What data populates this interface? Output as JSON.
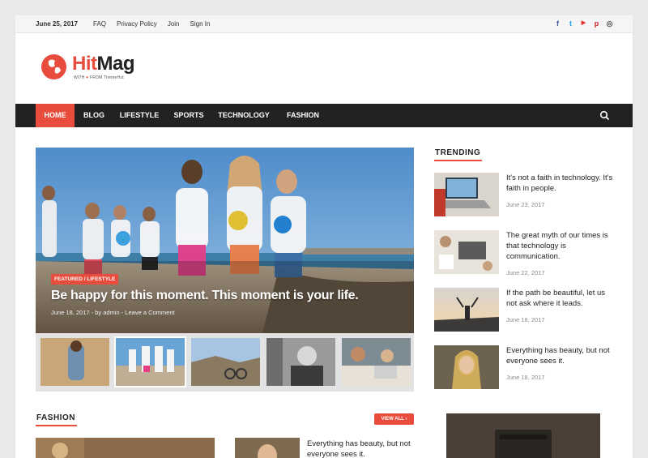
{
  "topbar": {
    "date": "June 25, 2017",
    "links": [
      "FAQ",
      "Privacy Policy",
      "Join",
      "Sign In"
    ],
    "social": [
      {
        "icon": "facebook-icon",
        "glyph": "f",
        "color": "#3b5998"
      },
      {
        "icon": "twitter-icon",
        "glyph": "t",
        "color": "#1da1f2"
      },
      {
        "icon": "youtube-icon",
        "glyph": "▶",
        "color": "#e52d27"
      },
      {
        "icon": "pinterest-icon",
        "glyph": "p",
        "color": "#cb2027"
      },
      {
        "icon": "instagram-icon",
        "glyph": "◎",
        "color": "#555555"
      }
    ]
  },
  "logo": {
    "hit": "Hit",
    "mag": "Mag",
    "tag_with": "WITH",
    "tag_heart": "♥",
    "tag_from": "FROM ThemeHut"
  },
  "nav": {
    "items": [
      "HOME",
      "BLOG",
      "LIFESTYLE",
      "SPORTS",
      "TECHNOLOGY",
      "FASHION"
    ],
    "active": "HOME"
  },
  "hero": {
    "category": "FEATURED / LIFESTYLE",
    "title": "Be happy for this moment. This moment is your life.",
    "meta": "June 18, 2017  -  by admin  -  Leave a Comment"
  },
  "trending": {
    "title": "TRENDING",
    "items": [
      {
        "title": "It's not a faith in technology. It's faith in people.",
        "date": "June 23, 2017"
      },
      {
        "title": "The great myth of our times is that technology is communication.",
        "date": "June 22, 2017"
      },
      {
        "title": "If the path be beautiful, let us not ask where it leads.",
        "date": "June 18, 2017"
      },
      {
        "title": "Everything has beauty, but not everyone sees it.",
        "date": "June 18, 2017"
      }
    ]
  },
  "fashion": {
    "title": "FASHION",
    "view_all": "VIEW ALL ›",
    "article_title": "Everything has beauty, but not everyone sees it."
  },
  "colors": {
    "accent": "#e74c3c",
    "nav_bg": "#222222"
  }
}
